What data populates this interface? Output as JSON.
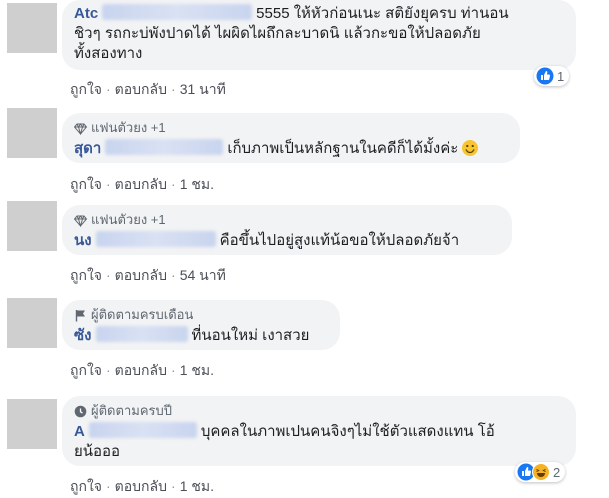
{
  "comments": [
    {
      "name": "Atc",
      "lines": [
        "5555 ให้หัวก่อนเนะ สติยังยุครบ ท่านอน",
        "ชิวๆ รถกะบ่พังปาดได้ ไผผิดไผถึกละบาดนิ แล้วกะขอให้ปลอดภัย",
        "ทั้งสองทาง"
      ],
      "like": "ถูกใจ",
      "reply": "ตอบกลับ",
      "time": "31 นาที",
      "reaction_count": "1"
    },
    {
      "badge": "แฟนตัวยง +1",
      "name": "สุดา",
      "text": "เก็บภาพเป็นหลักฐานในคดีก็ได้มั้งค่ะ",
      "like": "ถูกใจ",
      "reply": "ตอบกลับ",
      "time": "1 ชม."
    },
    {
      "badge": "แฟนตัวยง +1",
      "name": "นง",
      "text": "คือขึ้นไปอยู่สูงแท้น้อขอให้ปลอดภัยจ้า",
      "like": "ถูกใจ",
      "reply": "ตอบกลับ",
      "time": "54 นาที"
    },
    {
      "badge": "ผู้ติดตามครบเดือน",
      "name": "ซัง",
      "text": "ที่นอนใหม่ เงาสวย",
      "like": "ถูกใจ",
      "reply": "ตอบกลับ",
      "time": "1 ชม."
    },
    {
      "badge": "ผู้ติดตามครบปี",
      "name": "A",
      "lines": [
        "บุคคลในภาพเปนคนจิงๆไม่ใช้ตัวแสดงแทน โอ้",
        "ยน้อออ"
      ],
      "like": "ถูกใจ",
      "reply": "ตอบกลับ",
      "time": "1 ชม.",
      "reaction_count": "2"
    }
  ],
  "colors": {
    "name": "#385898",
    "bubble": "#f2f3f5",
    "meta": "#606770",
    "like_blue": "#1877f2",
    "haha_yellow": "#f7b125"
  },
  "icons": {
    "fan_badge": "diamond-icon",
    "month_badge": "flag-icon",
    "year_badge": "clock-badge-icon",
    "reaction_like": "like-reaction-icon",
    "reaction_haha": "haha-reaction-icon"
  }
}
